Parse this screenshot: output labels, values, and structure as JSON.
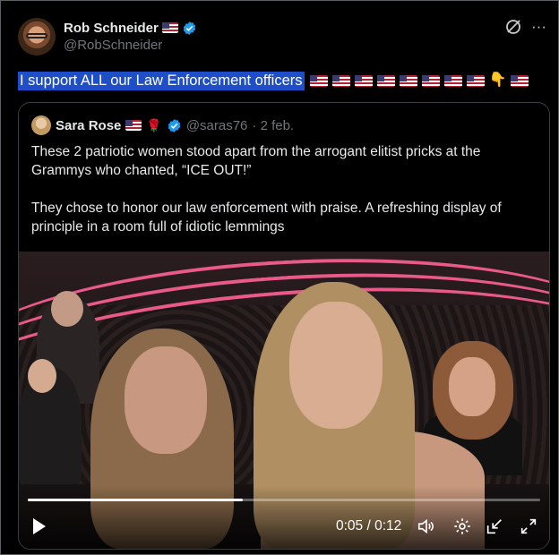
{
  "author": {
    "name": "Rob Schneider",
    "handle": "@RobSchneider",
    "name_flag_icon": "us-flag-icon",
    "verified_icon": "verified-badge-icon"
  },
  "top_actions": {
    "grok_icon": "grok-icon",
    "more_label": "···"
  },
  "tweet": {
    "text": "I support ALL our Law Enforcement officers",
    "emoji_icons": [
      "us-flag-icon",
      "us-flag-icon",
      "us-flag-icon",
      "us-flag-icon",
      "us-flag-icon",
      "us-flag-icon",
      "us-flag-icon",
      "us-flag-icon",
      "pointing-down-icon",
      "us-flag-icon"
    ],
    "point_emoji": "👇"
  },
  "quote": {
    "name": "Sara Rose",
    "handle": "@saras76",
    "date": "· 2 feb.",
    "rose_glyph": "🌹",
    "paragraph_1": "These 2 patriotic women stood apart from the arrogant elitist pricks at the Grammys who chanted, “ICE OUT!”",
    "paragraph_2": "They chose to honor our law enforcement with praise. A refreshing display of principle in a room full of idiotic lemmings"
  },
  "video": {
    "time_display": "0:05 / 0:12",
    "progress_fraction": 0.42,
    "colors": {
      "stage_lights": "#e95a8a",
      "progress": "#ffffff"
    }
  },
  "colors": {
    "accent": "#1d9bf0",
    "highlight": "#1f4fc8",
    "muted": "#71767b"
  }
}
